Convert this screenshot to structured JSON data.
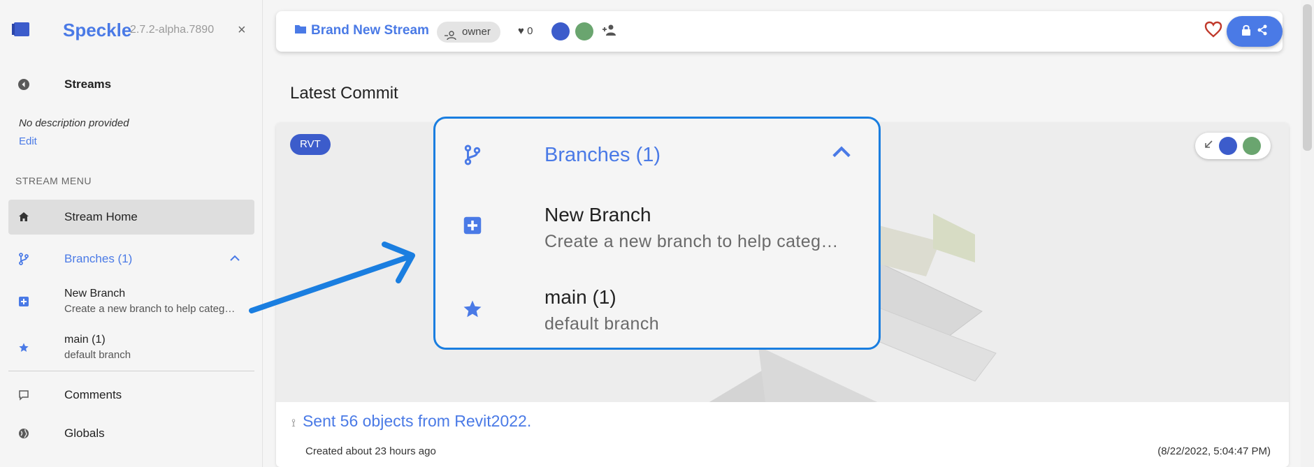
{
  "app": {
    "name": "Speckle",
    "version": "2.7.2-alpha.7890",
    "close_label": "×"
  },
  "sidebar": {
    "streams_label": "Streams",
    "description": "No description provided",
    "edit_label": "Edit",
    "section_title": "STREAM MENU",
    "home_label": "Stream Home",
    "branches_label": "Branches (1)",
    "new_branch": {
      "title": "New Branch",
      "desc": "Create a new branch to help categ…"
    },
    "main_branch": {
      "title": "main (1)",
      "desc": "default branch"
    },
    "comments_label": "Comments",
    "globals_label": "Globals"
  },
  "topbar": {
    "stream_name": "Brand New Stream",
    "role": "owner",
    "likes": "0"
  },
  "main": {
    "latest_commit_title": "Latest Commit",
    "source_badge": "RVT",
    "commit_message": "Sent 56 objects from Revit2022.",
    "created": "Created about 23 hours ago",
    "created_date": "(8/22/2022, 5:04:47 PM)"
  },
  "callout": {
    "branches_label": "Branches (1)",
    "new_branch_title": "New Branch",
    "new_branch_desc": "Create a new branch to help categ…",
    "main_title": "main (1)",
    "main_desc": "default branch"
  },
  "colors": {
    "accent": "#4a7ae6",
    "brand_dark": "#3c5ccb",
    "callout_border": "#1a7ee0",
    "heart": "#c0392b"
  }
}
